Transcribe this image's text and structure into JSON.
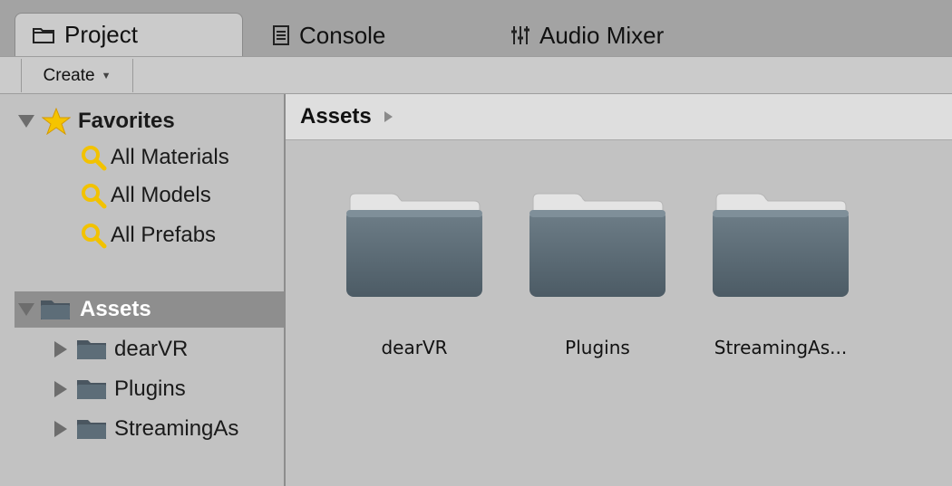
{
  "tabs": [
    {
      "label": "Project",
      "icon": "folder-icon",
      "active": true
    },
    {
      "label": "Console",
      "icon": "console-icon",
      "active": false
    },
    {
      "label": "Audio Mixer",
      "icon": "mixer-icon",
      "active": false
    }
  ],
  "toolbar": {
    "create_label": "Create",
    "create_caret": "▼"
  },
  "favorites": {
    "label": "Favorites",
    "icon": "star-icon",
    "items": [
      {
        "label": "All Materials",
        "icon": "search-icon"
      },
      {
        "label": "All Models",
        "icon": "search-icon"
      },
      {
        "label": "All Prefabs",
        "icon": "search-icon"
      }
    ]
  },
  "assets_tree": {
    "label": "Assets",
    "children": [
      {
        "label": "dearVR"
      },
      {
        "label": "Plugins"
      },
      {
        "label": "StreamingAs"
      }
    ]
  },
  "breadcrumb": {
    "label": "Assets"
  },
  "grid": {
    "items": [
      {
        "label": "dearVR",
        "icon": "folder-icon"
      },
      {
        "label": "Plugins",
        "icon": "folder-icon"
      },
      {
        "label": "StreamingAs...",
        "icon": "folder-icon"
      }
    ]
  },
  "colors": {
    "tabbar": "#a3a3a3",
    "panel": "#c2c2c2",
    "selected_row": "#8e8e8e",
    "folder": "#5d6d78",
    "star": "#f5c400"
  }
}
